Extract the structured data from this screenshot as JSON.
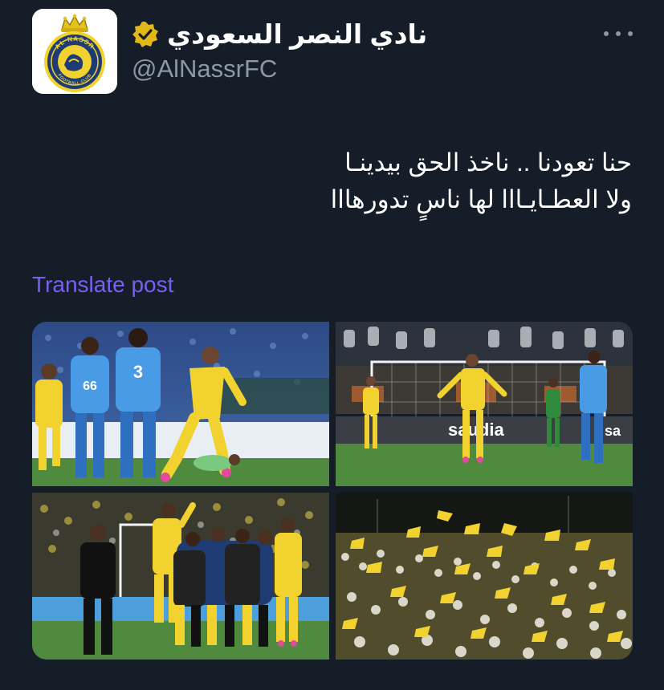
{
  "tweet": {
    "display_name": "نادي النصر السعودي",
    "handle": "@AlNassrFC",
    "text_lines": [
      "حنا تعودنا .. ناخذ الحق بيدينـا",
      "ولا العطـايـااا لها ناسٍ تدورهااا"
    ],
    "translate_label": "Translate post"
  },
  "avatar": {
    "logo_top_text": "AL NASSR",
    "logo_bottom_text": "FOOTBALL CLUB"
  },
  "photo_2": {
    "board_text": "saudia"
  },
  "photo_1": {
    "jersey_numbers": [
      "66",
      "3"
    ]
  },
  "icons": {
    "verified": "verified-badge-icon",
    "more": "more-options-icon"
  },
  "colors": {
    "background": "#151d28",
    "primary_text": "#ffffff",
    "secondary_text": "#8b98a5",
    "link": "#7a5ff5",
    "verified_badge": "#e2b719",
    "nassr_yellow": "#f2d22f",
    "nassr_blue": "#1f3b73",
    "hilal_blue": "#3d8fd8"
  }
}
